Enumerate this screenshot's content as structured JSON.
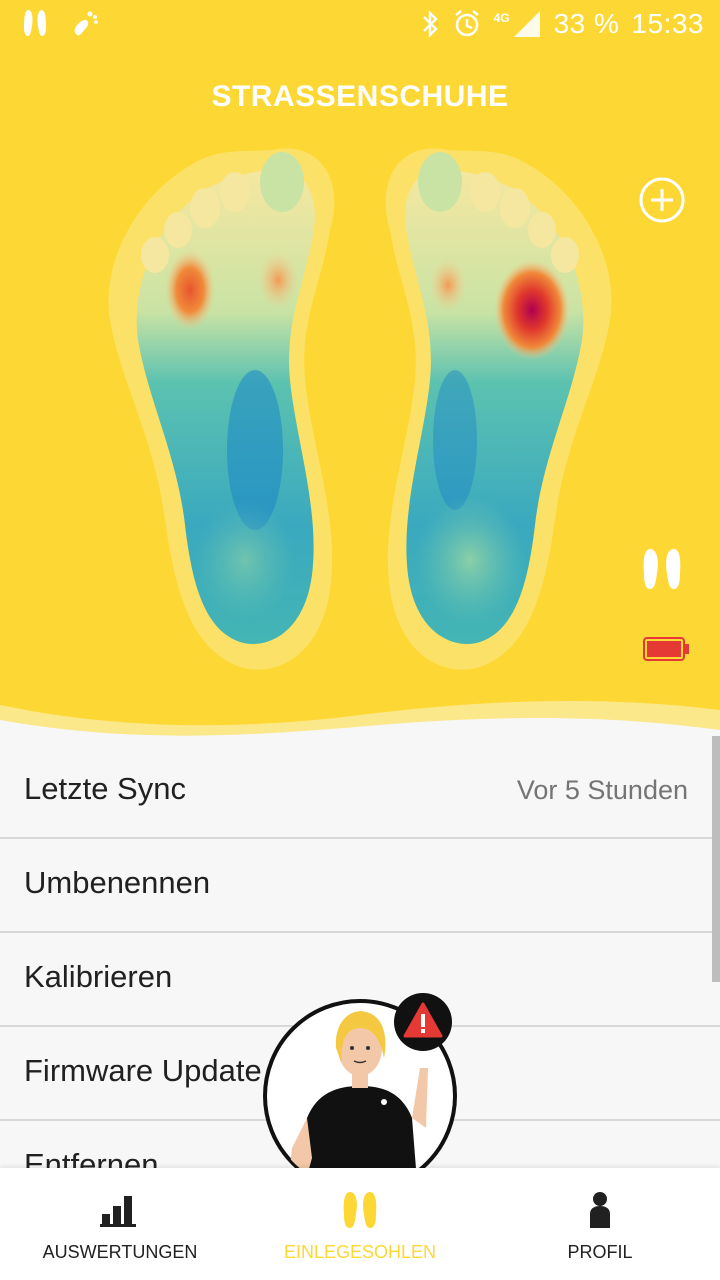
{
  "status_bar": {
    "battery": "33 %",
    "time": "15:33",
    "network": "4G",
    "icons": [
      "feet-icon",
      "walking-foot-icon",
      "bluetooth-icon",
      "alarm-icon",
      "signal-icon"
    ]
  },
  "header": {
    "title": "STRASSENSCHUHE",
    "background": "#fdd835",
    "actions": [
      "add-icon",
      "feet-icon",
      "battery-low-icon"
    ]
  },
  "heatmap": {
    "colors": [
      "#1c86c7",
      "#7fd0a8",
      "#f6e7a0",
      "#f08a3a",
      "#b00050"
    ]
  },
  "list": [
    {
      "label": "Letzte Sync",
      "value": "Vor 5 Stunden"
    },
    {
      "label": "Umbenennen",
      "value": ""
    },
    {
      "label": "Kalibrieren",
      "value": ""
    },
    {
      "label": "Firmware Update",
      "value": ""
    },
    {
      "label": "Entfernen",
      "value": ""
    }
  ],
  "nav": {
    "items": [
      {
        "label": "AUSWERTUNGEN",
        "icon": "bar-chart-icon",
        "active": false
      },
      {
        "label": "EINLEGESOHLEN",
        "icon": "insoles-icon",
        "active": true
      },
      {
        "label": "PROFIL",
        "icon": "person-icon",
        "active": false
      }
    ],
    "active_color": "#fdd835"
  }
}
